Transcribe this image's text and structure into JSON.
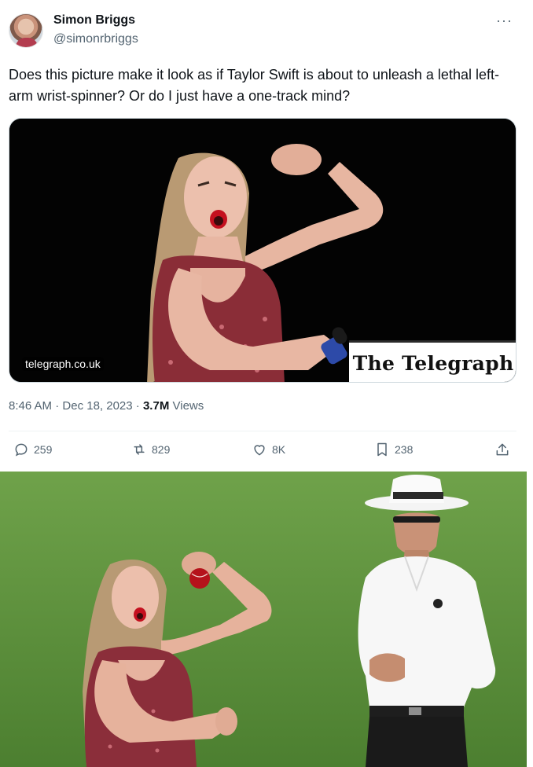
{
  "tweet": {
    "author_name": "Simon Briggs",
    "author_handle": "@simonrbriggs",
    "more_label": "···",
    "text": "Does this picture make it look as if Taylor Swift is about to unleash a lethal left-arm wrist-spinner? Or do I just have a one-track mind?",
    "card": {
      "domain": "telegraph.co.uk",
      "brand": "The Telegraph"
    },
    "time": "8:46 AM",
    "date": "Dec 18, 2023",
    "views_count": "3.7M",
    "views_label": "Views",
    "actions": {
      "replies": "259",
      "reposts": "829",
      "likes": "8K",
      "bookmarks": "238"
    }
  },
  "icons": [
    "reply-icon",
    "repost-icon",
    "like-icon",
    "bookmark-icon",
    "share-icon",
    "more-icon"
  ],
  "colors": {
    "text": "#0f1419",
    "secondary": "#536471",
    "divider": "#eff3f4",
    "pitch": "#5b8f3a"
  }
}
